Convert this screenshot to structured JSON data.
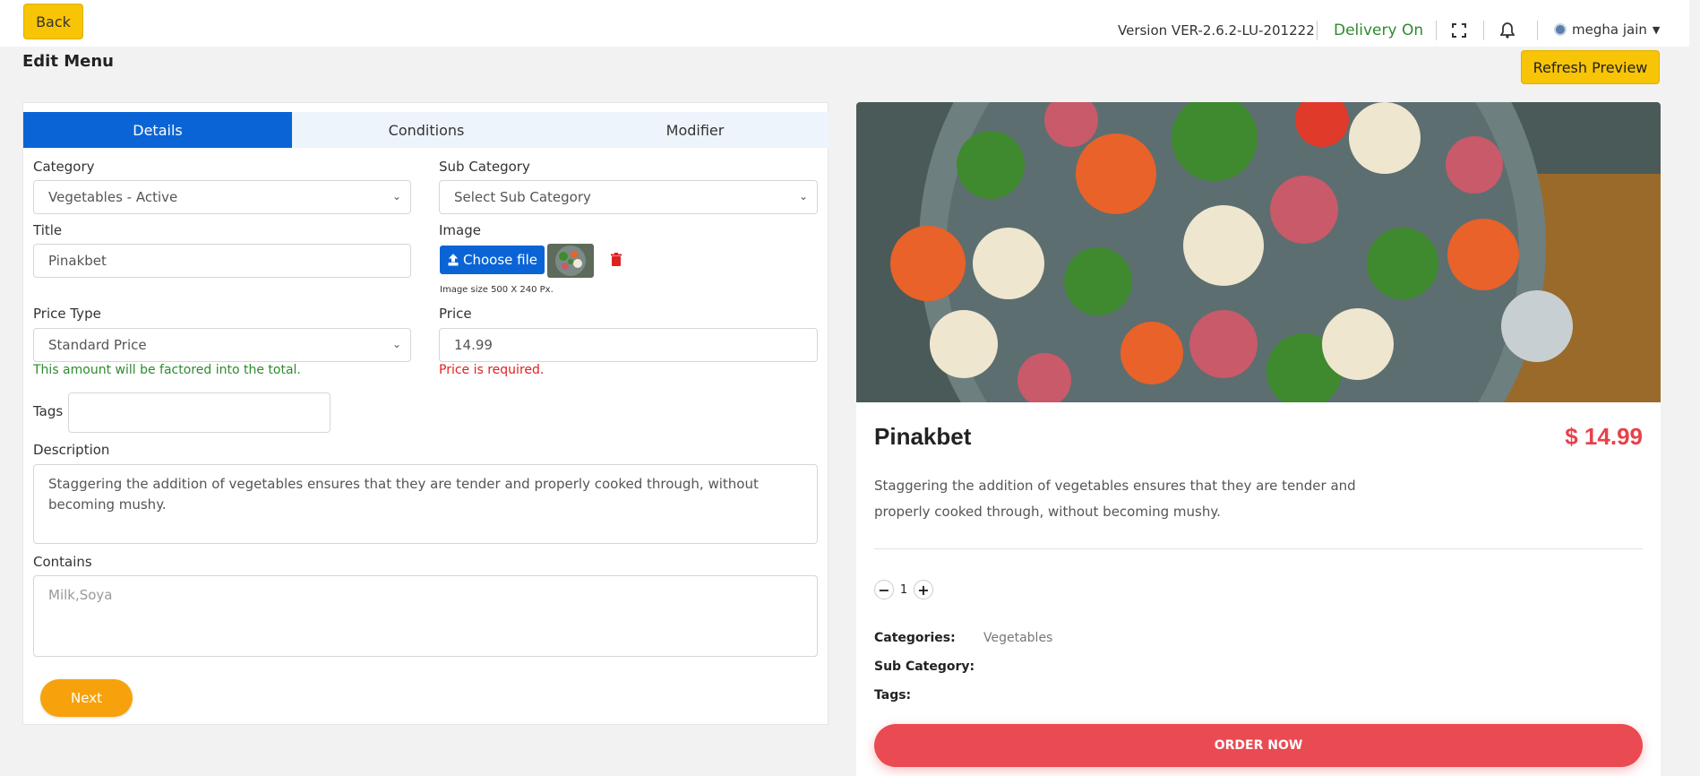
{
  "header": {
    "back_label": "Back",
    "version": "Version VER-2.6.2-LU-201222",
    "delivery": "Delivery On",
    "user_name": "megha jain",
    "page_title": "Edit Menu",
    "refresh_label": "Refresh Preview"
  },
  "tabs": [
    {
      "label": "Details",
      "active": true
    },
    {
      "label": "Conditions",
      "active": false
    },
    {
      "label": "Modifier",
      "active": false
    }
  ],
  "form": {
    "category_label": "Category",
    "category_value": "Vegetables - Active",
    "subcategory_label": "Sub Category",
    "subcategory_value": "Select Sub Category",
    "title_label": "Title",
    "title_value": "Pinakbet",
    "image_label": "Image",
    "choose_file_label": "Choose file",
    "image_size_hint": "Image size 500 X 240 Px.",
    "price_type_label": "Price Type",
    "price_type_value": "Standard Price",
    "price_type_hint": "This amount will be factored into the total.",
    "price_label": "Price",
    "price_value": "14.99",
    "price_error": "Price is required.",
    "tags_label": "Tags",
    "tags_value": "",
    "description_label": "Description",
    "description_value": "Staggering the addition of vegetables ensures that they are tender and properly cooked through, without becoming mushy.",
    "contains_label": "Contains",
    "contains_placeholder": "Milk,Soya",
    "next_label": "Next"
  },
  "preview": {
    "name": "Pinakbet",
    "price": "$ 14.99",
    "description": "Staggering the addition of vegetables ensures that they are tender and properly cooked through, without becoming mushy.",
    "quantity": "1",
    "categories_label": "Categories:",
    "categories_value": "Vegetables",
    "subcategory_label": "Sub Category:",
    "tags_label": "Tags:",
    "order_label": "ORDER NOW"
  },
  "colors": {
    "accent_yellow": "#f7c406",
    "tab_active_blue": "#0a64d6",
    "next_orange": "#f7a20c",
    "success_green": "#2e8b2e",
    "error_red": "#e02020",
    "price_red": "#e8414a",
    "order_red": "#ea4a52"
  },
  "icons": [
    "upload-icon",
    "trash-icon",
    "fullscreen-icon",
    "bell-icon",
    "user-avatar-icon",
    "chevron-down-icon",
    "minus-icon",
    "plus-icon"
  ]
}
